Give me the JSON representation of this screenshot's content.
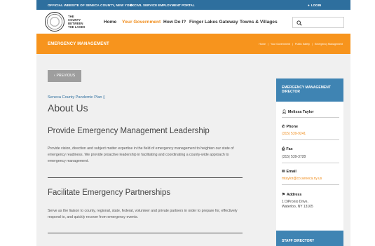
{
  "topbar": {
    "official": "OFFICIAL WEBSITE OF SENECA COUNTY, NEW YORK",
    "civil": "CIVIL SERVICE EMPLOYMENT PORTAL",
    "login": "LOGIN"
  },
  "logo": {
    "line1": "THE",
    "line2": "COUNTY",
    "line3": "BETWEEN",
    "line4": "THE LAKES"
  },
  "nav": {
    "home": "Home",
    "gov": "Your Government",
    "how": "How Do I?",
    "flg": "Finger Lakes Gateway",
    "towns": "Towns & Villages"
  },
  "banner": {
    "title": "EMERGENCY MANAGEMENT",
    "crumbs": [
      "Home",
      "Your Government",
      "Public Safety",
      "Emergency Management"
    ],
    "sep": "|"
  },
  "main": {
    "prev": "PREVIOUS",
    "plan_link": "Seneca County Pandemic Plan",
    "title": "About Us",
    "s1_title": "Provide Emergency Management Leadership",
    "s1_text": "Provide vision, direction and subject matter expertise in the field of emergency management to heighten our state of emergency readiness. We provide proactive leadership in facilitating and coordinating a county-wide approach to emergency management.",
    "s2_title": "Facilitate Emergency Partnerships",
    "s2_text": "Serve as the liaison to county, regional, state, federal, volunteer and private partners in order to prepare for, effectively respond to, and quickly recover from emergency events."
  },
  "sidebar": {
    "title": "EMERGENCY MANAGEMENT DIRECTOR",
    "name": "Melissa Taylor",
    "phone_label": "Phone",
    "phone": "(315) 539-9241",
    "fax_label": "Fax",
    "fax": "(315) 539-3728",
    "email_label": "Email",
    "email": "mtaylor@co.seneca.ny.us",
    "address_label": "Address",
    "address1": "1 DiPronio Drive,",
    "address2": "Waterloo, NY 13165",
    "staff": "STAFF DIRECTORY"
  },
  "colors": {
    "topbar": "#2e6f9e",
    "accent": "#f7941d",
    "sidebar_head": "#3f84b3"
  }
}
